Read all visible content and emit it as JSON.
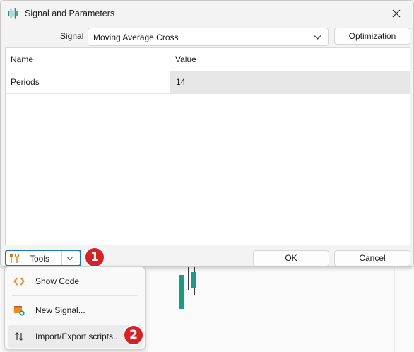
{
  "window": {
    "title": "Signal and Parameters",
    "icon": "signal-waveform-icon",
    "close_icon": "close-icon"
  },
  "signal": {
    "label": "Signal",
    "selected": "Moving Average Cross"
  },
  "optimization_label": "Optimization",
  "grid": {
    "columns": [
      "Name",
      "Value"
    ],
    "rows": [
      {
        "name": "Periods",
        "value": "14"
      }
    ]
  },
  "tools": {
    "label": "Tools",
    "icon": "tools-icon"
  },
  "buttons": {
    "ok": "OK",
    "cancel": "Cancel"
  },
  "menu": {
    "items": [
      {
        "label": "Show Code",
        "icon": "code-icon"
      },
      {
        "label": "New Signal...",
        "icon": "new-signal-icon"
      },
      {
        "label": "Import/Export scripts...",
        "icon": "import-export-icon"
      }
    ]
  },
  "annotations": {
    "badge_1": "1",
    "badge_2": "2"
  },
  "colors": {
    "accent_border": "#1777c9",
    "badge_red": "#d92024",
    "code_icon": "#f08a24",
    "new_signal_icon": "#f08a24",
    "new_signal_plus": "#1a9c83",
    "candle_green": "#1a9c83"
  }
}
